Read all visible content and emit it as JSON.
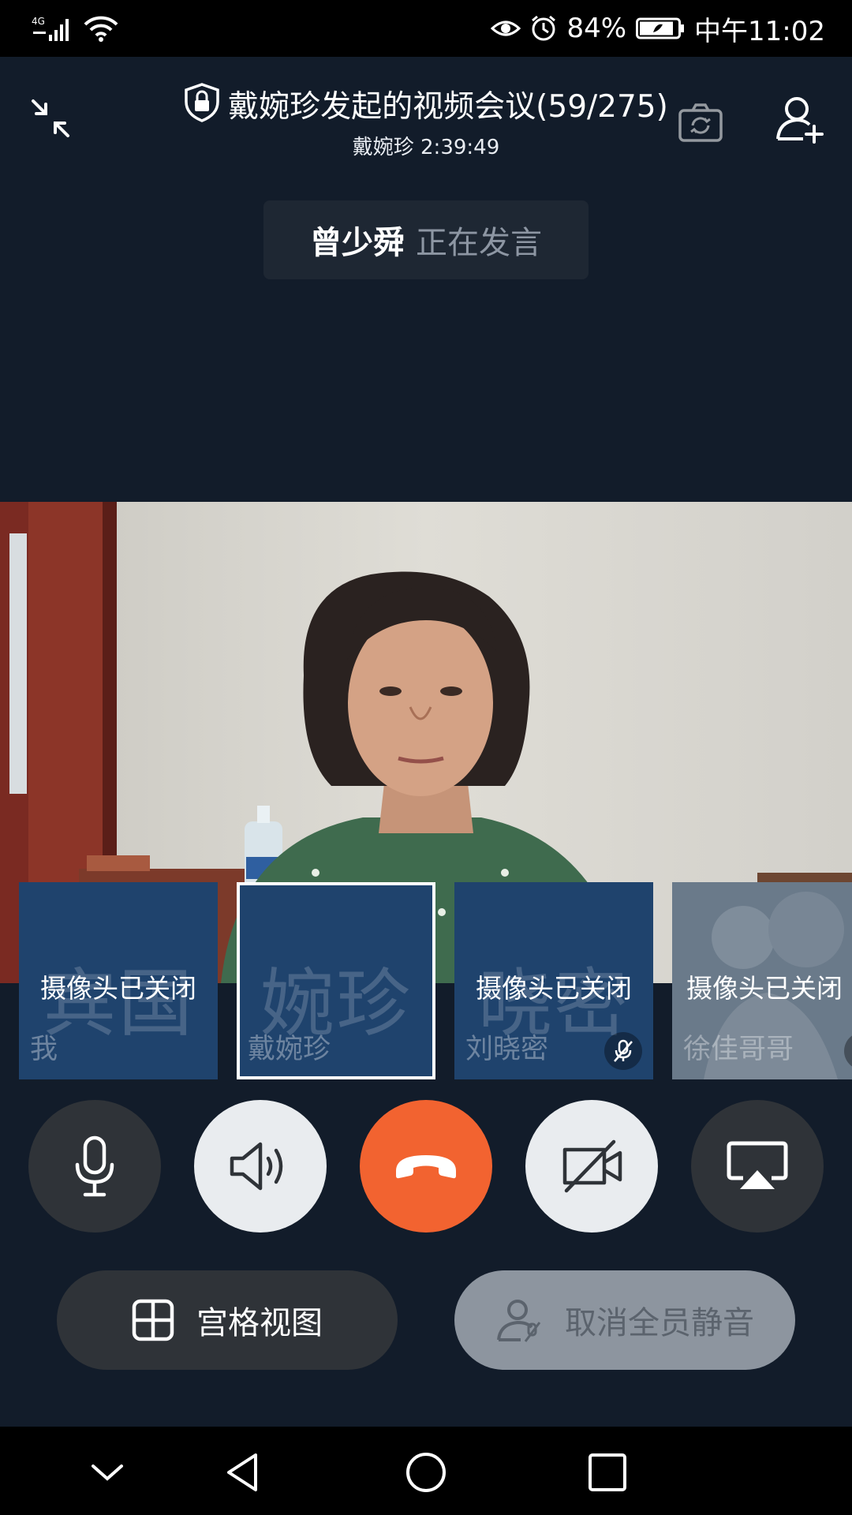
{
  "status_bar": {
    "network": "4G",
    "battery_percent": "84%",
    "time": "中午11:02",
    "icons": [
      "signal-icon",
      "wifi-icon",
      "eye-icon",
      "alarm-icon",
      "battery-icon"
    ]
  },
  "header": {
    "title": "戴婉珍发起的视频会议(59/275)",
    "subtitle": "戴婉珍 2:39:49"
  },
  "speaking": {
    "name": "曾少舜",
    "status": "正在发言"
  },
  "thumbnails": [
    {
      "avatar_text": "宾国",
      "overlay": "摄像头已关闭",
      "name": "我",
      "muted": false,
      "selected": false
    },
    {
      "avatar_text": "婉珍",
      "overlay": "",
      "name": "戴婉珍",
      "muted": false,
      "selected": true
    },
    {
      "avatar_text": "晓密",
      "overlay": "摄像头已关闭",
      "name": "刘晓密",
      "muted": true,
      "selected": false
    },
    {
      "avatar_text": "",
      "overlay": "摄像头已关闭",
      "name": "徐佳哥哥",
      "muted": true,
      "selected": false
    }
  ],
  "controls": {
    "microphone": "microphone-icon",
    "speaker": "speaker-icon",
    "hangup": "hangup-icon",
    "camera": "camera-off-icon",
    "screen_share": "screen-share-icon"
  },
  "buttons": {
    "grid_view": "宫格视图",
    "unmute_all": "取消全员静音"
  },
  "colors": {
    "background": "#121c2a",
    "hangup": "#f26330",
    "thumb_bg": "#1f436d"
  }
}
